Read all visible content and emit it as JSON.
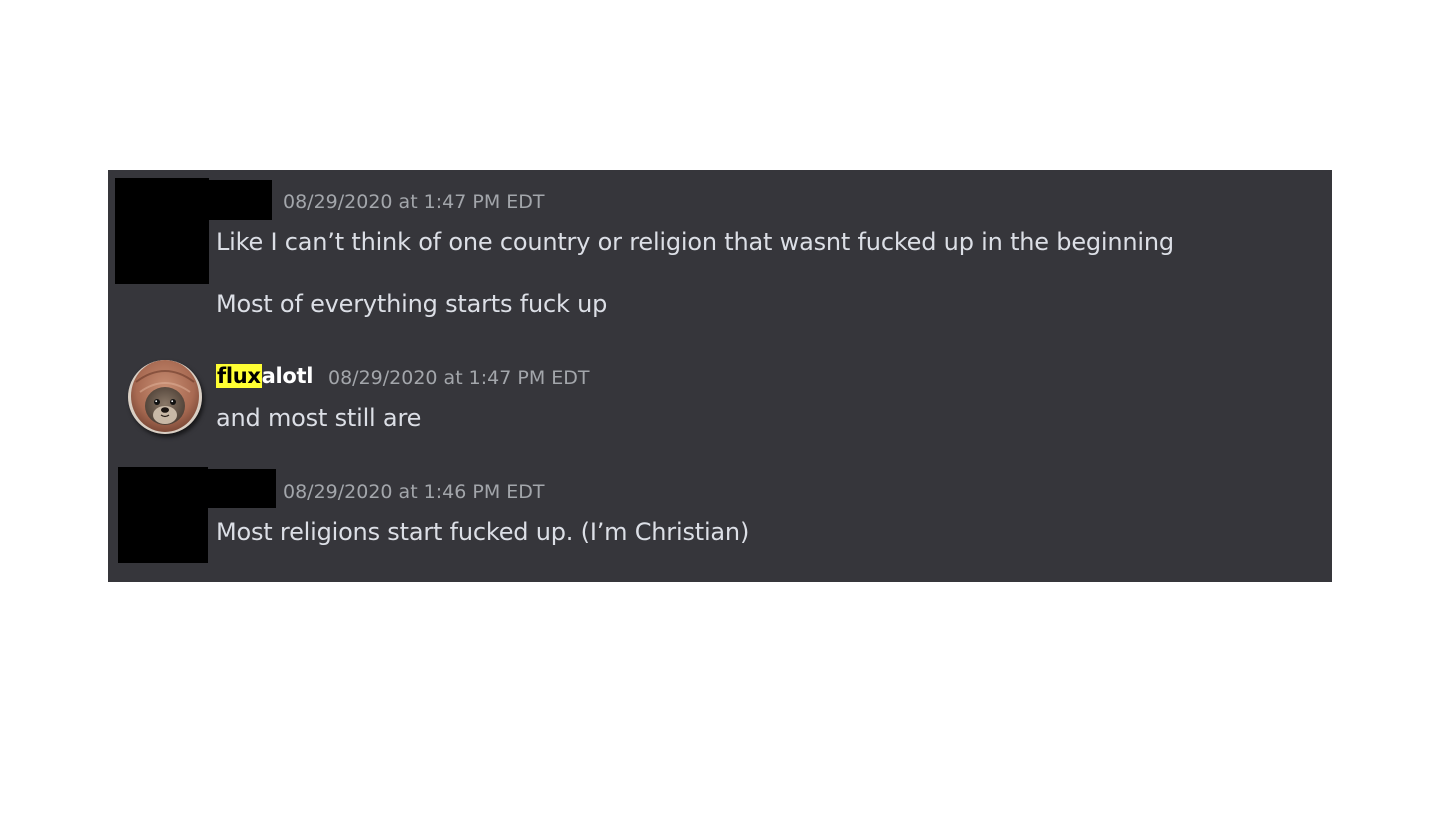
{
  "messages": [
    {
      "author": "",
      "timestamp": "08/29/2020 at 1:47 PM EDT",
      "lines": [
        "Like I can’t think of one country or religion that wasnt fucked up in the beginning",
        "Most of everything starts fuck up"
      ]
    },
    {
      "author_highlighted": "flux",
      "author_rest": "alotl",
      "timestamp": "08/29/2020 at 1:47 PM EDT",
      "lines": [
        "and most still are"
      ],
      "avatar_icon": "otter-avatar-icon"
    },
    {
      "author": "",
      "timestamp": "08/29/2020 at 1:46 PM EDT",
      "lines": [
        "Most religions start fucked up. (I’m Christian)"
      ]
    }
  ],
  "colors": {
    "panel_bg": "#36363b",
    "message_text": "#dcdfe6",
    "timestamp": "#a3a6ab",
    "username": "#ffffff",
    "highlight": "#ffff33",
    "redaction": "#000000"
  }
}
